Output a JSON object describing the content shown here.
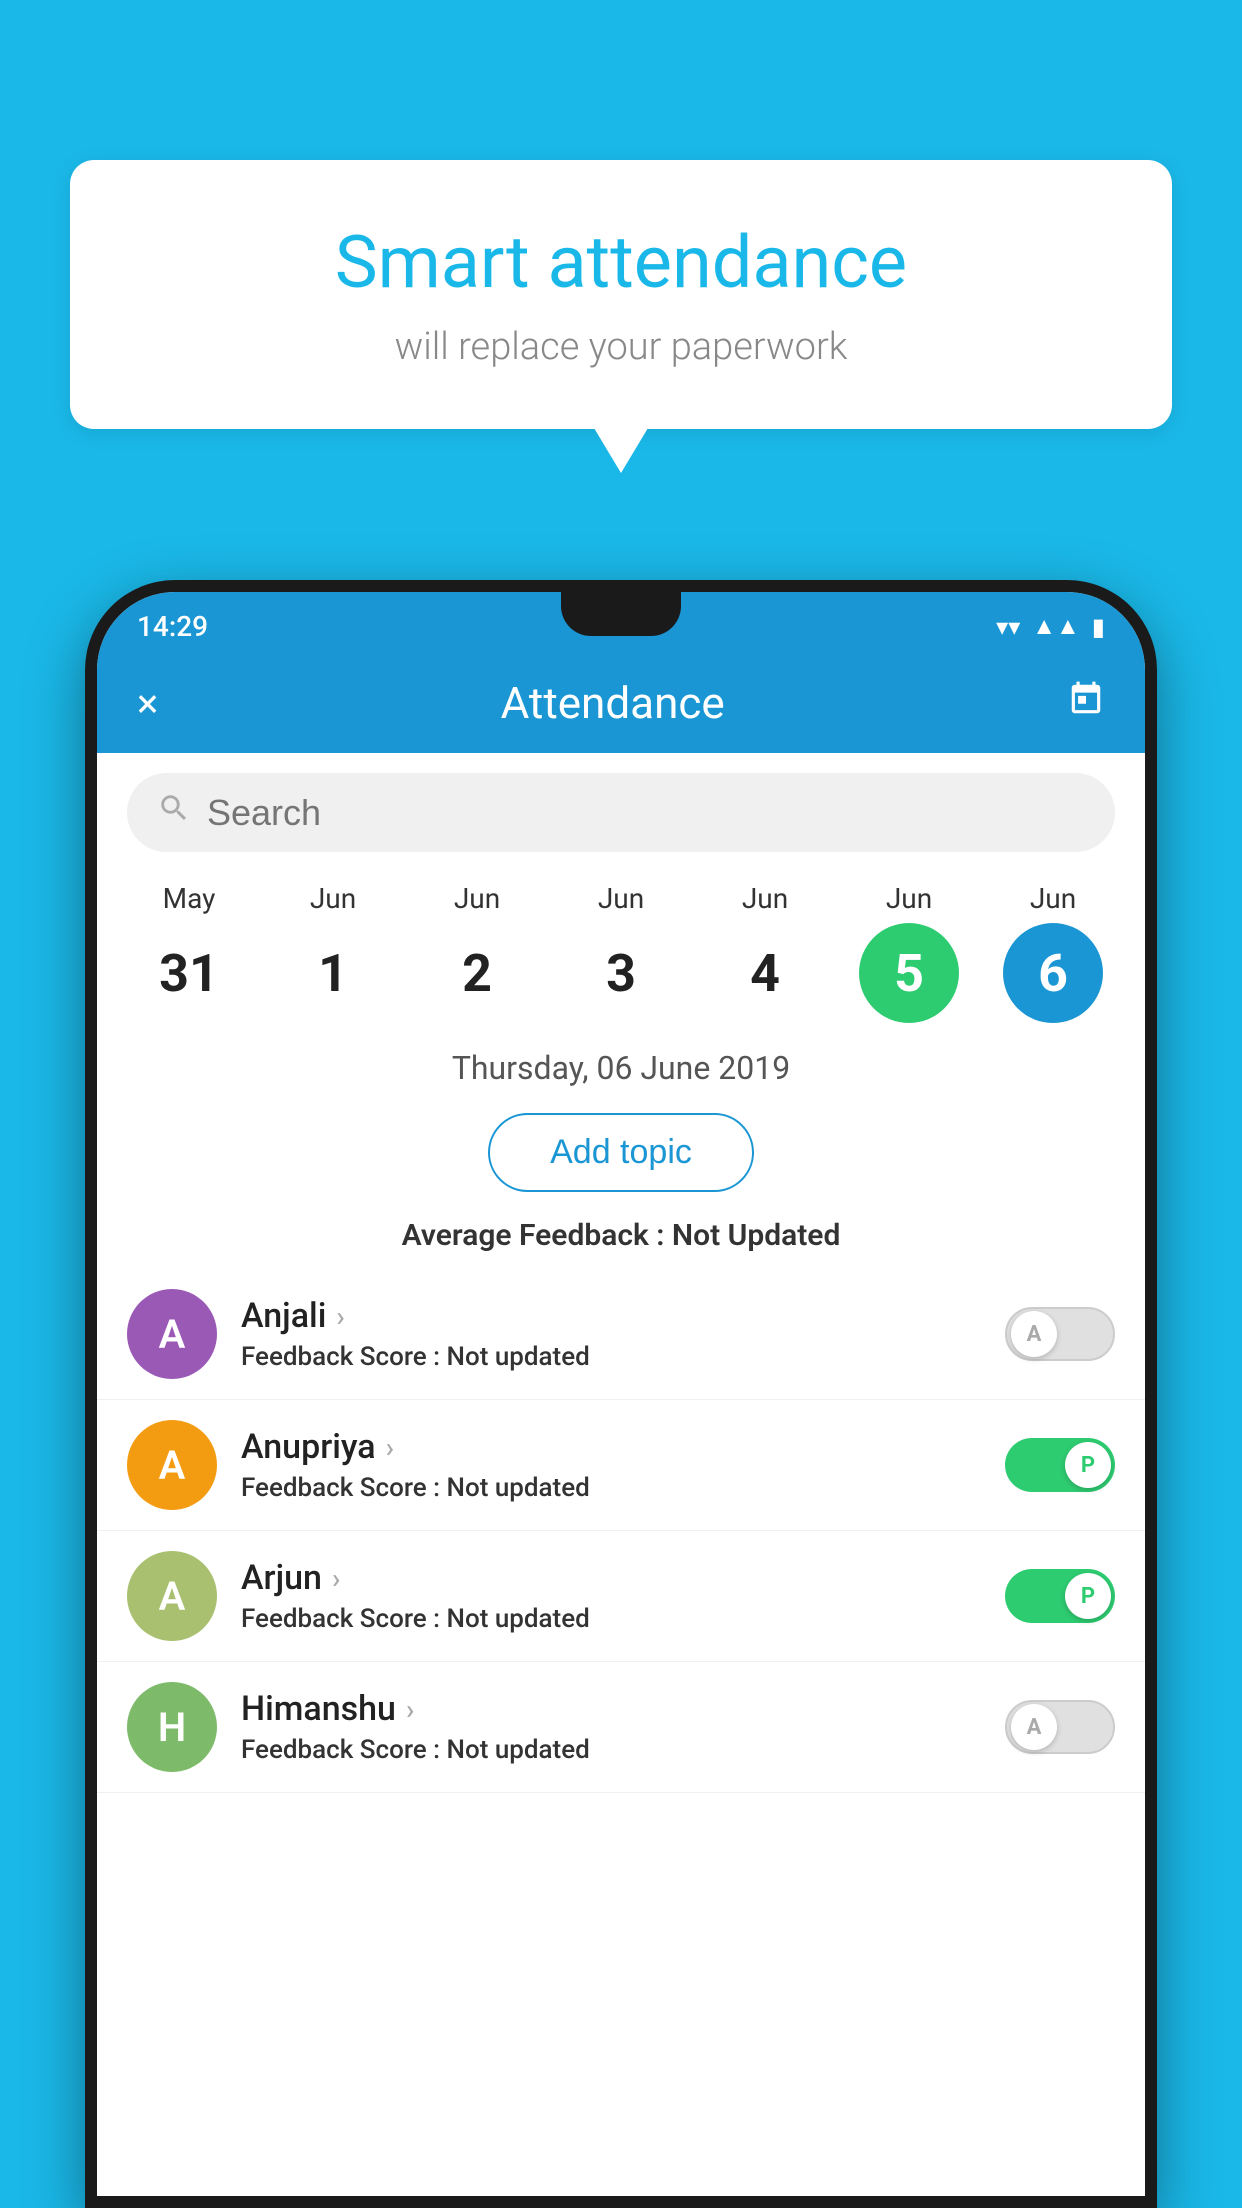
{
  "background_color": "#1ab8e8",
  "bubble": {
    "title": "Smart attendance",
    "subtitle": "will replace your paperwork"
  },
  "phone": {
    "status_bar": {
      "time": "14:29",
      "icons": [
        "wifi",
        "signal",
        "battery"
      ]
    },
    "header": {
      "close_label": "×",
      "title": "Attendance",
      "calendar_icon": "📅"
    },
    "search": {
      "placeholder": "Search"
    },
    "calendar": {
      "months": [
        "May",
        "Jun",
        "Jun",
        "Jun",
        "Jun",
        "Jun",
        "Jun"
      ],
      "days": [
        "31",
        "1",
        "2",
        "3",
        "4",
        "5",
        "6"
      ],
      "today_index": 5,
      "selected_index": 6
    },
    "selected_date": "Thursday, 06 June 2019",
    "add_topic_label": "Add topic",
    "avg_feedback": {
      "label": "Average Feedback : ",
      "value": "Not Updated"
    },
    "students": [
      {
        "name": "Anjali",
        "avatar_letter": "A",
        "avatar_color": "#9b59b6",
        "feedback": "Feedback Score : ",
        "feedback_value": "Not updated",
        "toggle_state": "off",
        "toggle_label": "A"
      },
      {
        "name": "Anupriya",
        "avatar_letter": "A",
        "avatar_color": "#f39c12",
        "feedback": "Feedback Score : ",
        "feedback_value": "Not updated",
        "toggle_state": "on",
        "toggle_label": "P"
      },
      {
        "name": "Arjun",
        "avatar_letter": "A",
        "avatar_color": "#a8c070",
        "feedback": "Feedback Score : ",
        "feedback_value": "Not updated",
        "toggle_state": "on",
        "toggle_label": "P"
      },
      {
        "name": "Himanshu",
        "avatar_letter": "H",
        "avatar_color": "#7dba6a",
        "feedback": "Feedback Score : ",
        "feedback_value": "Not updated",
        "toggle_state": "off",
        "toggle_label": "A"
      }
    ]
  }
}
